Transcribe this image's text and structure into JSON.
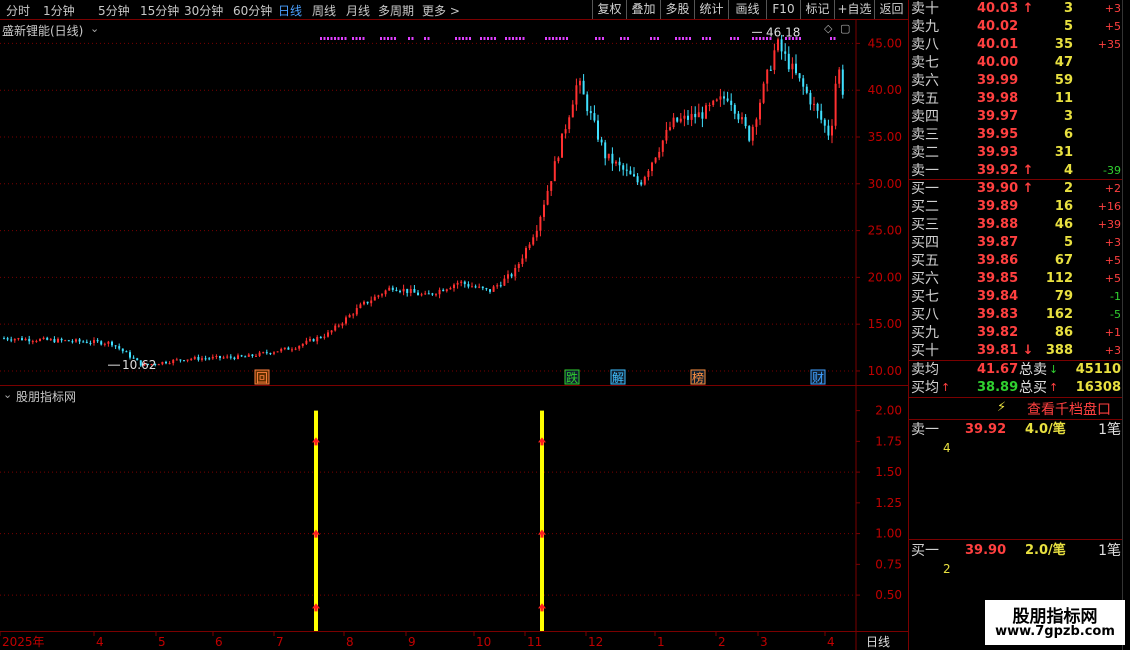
{
  "toolbar": {
    "periods": [
      "分时",
      "1分钟",
      "5分钟",
      "15分钟",
      "30分钟",
      "60分钟",
      "日线",
      "周线",
      "月线",
      "多周期",
      "更多 >"
    ],
    "buttons": [
      "复权",
      "叠加",
      "多股",
      "统计",
      "画线",
      "F10",
      "标记",
      "+自选",
      "返回"
    ]
  },
  "main_chart": {
    "title": "盛新锂能(日线)",
    "high_label": "46.18",
    "low_label": "10.62",
    "event_tags": [
      "回",
      "跌",
      "解",
      "榜",
      "财"
    ]
  },
  "indicator": {
    "title": "股朋指标网"
  },
  "date_axis": {
    "labels": [
      "2025年",
      "4",
      "5",
      "6",
      "7",
      "8",
      "9",
      "10",
      "11",
      "12",
      "1",
      "2",
      "3",
      "4"
    ],
    "period_label": "日线"
  },
  "chart_data": [
    {
      "type": "candlestick",
      "title": "盛新锂能(日线)",
      "ylim": [
        8.5,
        47.5
      ],
      "y_ticks": [
        "45.00",
        "40.00",
        "35.00",
        "30.00",
        "25.00",
        "20.00",
        "15.00",
        "10.00"
      ],
      "x_tick_labels": [
        "2025年",
        "4",
        "5",
        "6",
        "7",
        "8",
        "9",
        "10",
        "11",
        "12",
        "1",
        "2",
        "3",
        "4"
      ],
      "max_label": 46.18,
      "min_label": 10.62,
      "approx_close_path": [
        [
          "2025年",
          13.5
        ],
        [
          "4",
          13.0
        ],
        [
          "4",
          10.6
        ],
        [
          "5",
          11.3
        ],
        [
          "6",
          11.5
        ],
        [
          "7",
          12.5
        ],
        [
          "7",
          14.0
        ],
        [
          "8",
          17.0
        ],
        [
          "8",
          19.0
        ],
        [
          "9",
          18.0
        ],
        [
          "9",
          19.5
        ],
        [
          "10",
          18.5
        ],
        [
          "10",
          20.5
        ],
        [
          "11",
          25.5
        ],
        [
          "11",
          33.0
        ],
        [
          "11",
          41.0
        ],
        [
          "12",
          33.0
        ],
        [
          "12",
          30.0
        ],
        [
          "1",
          36.5
        ],
        [
          "1",
          37.5
        ],
        [
          "2",
          39.5
        ],
        [
          "2",
          35.0
        ],
        [
          "3",
          45.0
        ],
        [
          "3",
          39.0
        ],
        [
          "4",
          35.0
        ],
        [
          "4",
          43.0
        ],
        [
          "4",
          39.0
        ]
      ]
    },
    {
      "type": "indicator",
      "title": "股朋指标网",
      "ylim": [
        0.2,
        2.2
      ],
      "y_ticks": [
        "2.00",
        "1.75",
        "1.50",
        "1.25",
        "1.00",
        "0.75",
        "0.50"
      ],
      "signal_bars": [
        "7",
        "11"
      ]
    }
  ],
  "orderbook": {
    "asks": [
      {
        "label": "卖十",
        "price": "40.03",
        "vol": "3",
        "chg": "+3",
        "flag": "up"
      },
      {
        "label": "卖九",
        "price": "40.02",
        "vol": "5",
        "chg": "+5",
        "flag": ""
      },
      {
        "label": "卖八",
        "price": "40.01",
        "vol": "35",
        "chg": "+35",
        "flag": ""
      },
      {
        "label": "卖七",
        "price": "40.00",
        "vol": "47",
        "chg": "",
        "flag": ""
      },
      {
        "label": "卖六",
        "price": "39.99",
        "vol": "59",
        "chg": "",
        "flag": ""
      },
      {
        "label": "卖五",
        "price": "39.98",
        "vol": "11",
        "chg": "",
        "flag": ""
      },
      {
        "label": "卖四",
        "price": "39.97",
        "vol": "3",
        "chg": "",
        "flag": ""
      },
      {
        "label": "卖三",
        "price": "39.95",
        "vol": "6",
        "chg": "",
        "flag": ""
      },
      {
        "label": "卖二",
        "price": "39.93",
        "vol": "31",
        "chg": "",
        "flag": ""
      },
      {
        "label": "卖一",
        "price": "39.92",
        "vol": "4",
        "chg": "-39",
        "flag": "up"
      }
    ],
    "bids": [
      {
        "label": "买一",
        "price": "39.90",
        "vol": "2",
        "chg": "+2",
        "flag": "up"
      },
      {
        "label": "买二",
        "price": "39.89",
        "vol": "16",
        "chg": "+16",
        "flag": ""
      },
      {
        "label": "买三",
        "price": "39.88",
        "vol": "46",
        "chg": "+39",
        "flag": ""
      },
      {
        "label": "买四",
        "price": "39.87",
        "vol": "5",
        "chg": "+3",
        "flag": ""
      },
      {
        "label": "买五",
        "price": "39.86",
        "vol": "67",
        "chg": "+5",
        "flag": ""
      },
      {
        "label": "买六",
        "price": "39.85",
        "vol": "112",
        "chg": "+5",
        "flag": ""
      },
      {
        "label": "买七",
        "price": "39.84",
        "vol": "79",
        "chg": "-1",
        "flag": ""
      },
      {
        "label": "买八",
        "price": "39.83",
        "vol": "162",
        "chg": "-5",
        "flag": ""
      },
      {
        "label": "买九",
        "price": "39.82",
        "vol": "86",
        "chg": "+1",
        "flag": ""
      },
      {
        "label": "买十",
        "price": "39.81",
        "vol": "388",
        "chg": "+3",
        "flag": "down"
      }
    ],
    "summary": {
      "ask_avg_label": "卖均",
      "ask_avg": "41.67",
      "ask_total_label": "总卖",
      "ask_total": "45110",
      "bid_avg_label": "买均",
      "bid_avg": "38.89",
      "bid_total_label": "总买",
      "bid_total": "16308"
    },
    "thousand_button": "查看千档盘口",
    "ask1": {
      "label": "卖一",
      "price": "39.92",
      "per": "4.0/笔",
      "count": "1笔",
      "detail": "4"
    },
    "bid1": {
      "label": "买一",
      "price": "39.90",
      "per": "2.0/笔",
      "count": "1笔",
      "detail": "2"
    }
  },
  "logo": {
    "title": "股朋指标网",
    "url": "www.7gpzb.com"
  },
  "colors": {
    "up": "#ff3030",
    "down": "#40e0ff",
    "grid": "#7a0000",
    "signal": "#ffff00",
    "dots": "#e040ff"
  }
}
